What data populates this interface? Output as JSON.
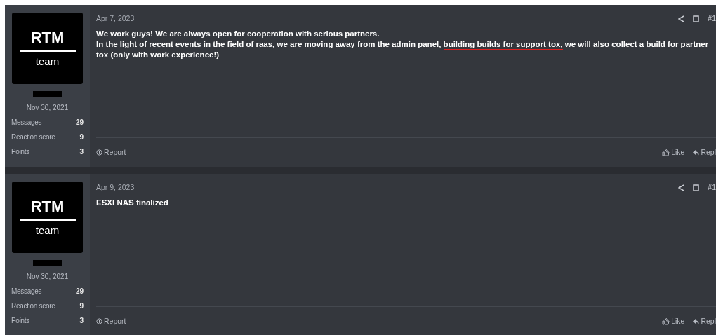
{
  "posts": [
    {
      "avatar": {
        "line_1": "RTM",
        "line_2": "team"
      },
      "username_redacted": true,
      "joined": "Nov 30, 2021",
      "stats": [
        {
          "label": "Messages",
          "value": "29"
        },
        {
          "label": "Reaction score",
          "value": "9"
        },
        {
          "label": "Points",
          "value": "3"
        }
      ],
      "date": "Apr 7, 2023",
      "post_number": "#1",
      "message": [
        [
          {
            "text": "We work guys! We are always open for cooperation with serious partners.",
            "underlined": false
          }
        ],
        [
          {
            "text": "In the light of recent events in the field of raas, we are moving away from the admin panel, ",
            "underlined": false
          },
          {
            "text": "building builds for support tox,",
            "underlined": true
          },
          {
            "text": " we will also collect a build for partner tox (only with work experience!)",
            "underlined": false
          }
        ]
      ],
      "report": "Report",
      "like": "Like",
      "reply": "Repl"
    },
    {
      "avatar": {
        "line_1": "RTM",
        "line_2": "team"
      },
      "username_redacted": true,
      "joined": "Nov 30, 2021",
      "stats": [
        {
          "label": "Messages",
          "value": "29"
        },
        {
          "label": "Reaction score",
          "value": "9"
        },
        {
          "label": "Points",
          "value": "3"
        }
      ],
      "date": "Apr 9, 2023",
      "post_number": "#1",
      "message": [
        [
          {
            "text": "ESXI NAS finalized",
            "underlined": false
          }
        ]
      ],
      "report": "Report",
      "like": "Like",
      "reply": "Repl"
    }
  ]
}
